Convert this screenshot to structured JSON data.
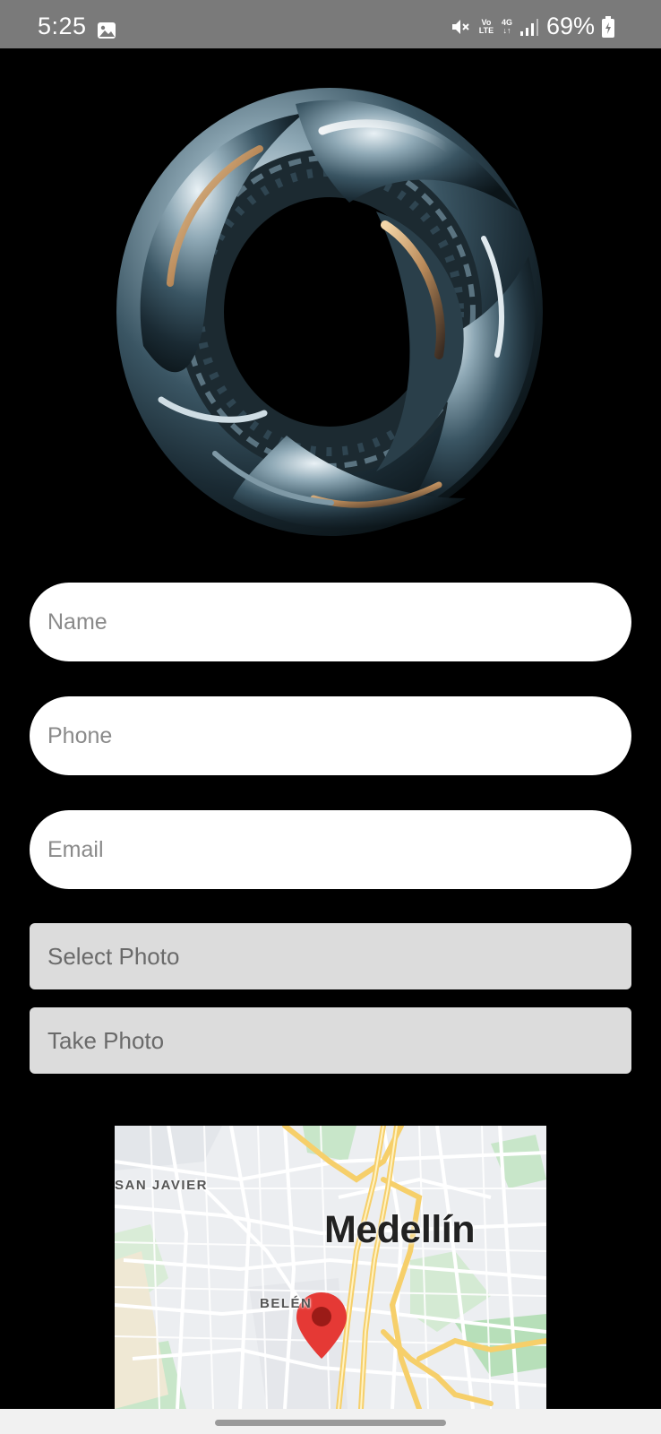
{
  "status_bar": {
    "time": "5:25",
    "volte": "Vo LTE",
    "network": "4G",
    "battery_percent": "69%"
  },
  "form": {
    "name_placeholder": "Name",
    "phone_placeholder": "Phone",
    "email_placeholder": "Email",
    "select_photo_label": "Select Photo",
    "take_photo_label": "Take Photo"
  },
  "map": {
    "city_label": "Medellín",
    "district_label_1": "SAN JAVIER",
    "district_label_2": "BELÉN"
  },
  "colors": {
    "background": "#000000",
    "status_bar": "#7a7a7a",
    "input_bg": "#ffffff",
    "button_bg": "#dcdcdc",
    "marker": "#e53935"
  }
}
